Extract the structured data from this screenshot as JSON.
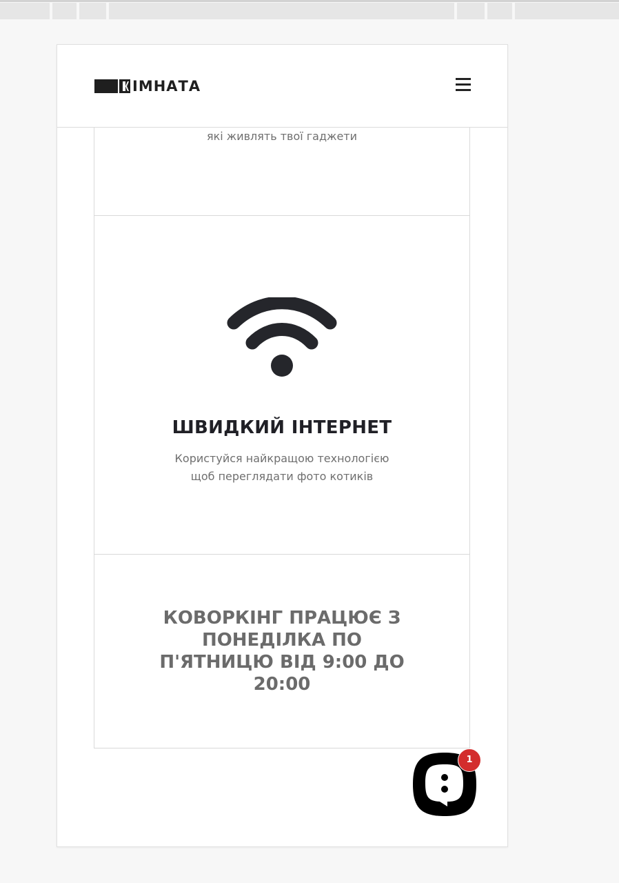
{
  "header": {
    "logo_text": "ІМНАТА",
    "menu_icon": "hamburger-menu-icon"
  },
  "features": [
    {
      "description": "які живлять твої гаджети"
    },
    {
      "icon": "wifi-icon",
      "title": "ШВИДКИЙ ІНТЕРНЕТ",
      "description_line1": "Користуйся найкращою технологією",
      "description_line2": "щоб переглядати фото котиків"
    }
  ],
  "schedule": {
    "line1": "КОВОРКІНГ ПРАЦЮЄ З",
    "line2": "ПОНЕДІЛКА ПО",
    "line3": "П'ЯТНИЦЮ ВІД 9:00 ДО",
    "line4": "20:00"
  },
  "chat": {
    "icon": "chat-bubble-icon",
    "badge_count": "1"
  },
  "colors": {
    "text_dark": "#202026",
    "text_muted": "#6f6f6f",
    "badge": "#d32d2d",
    "border": "#d9d9d9"
  }
}
